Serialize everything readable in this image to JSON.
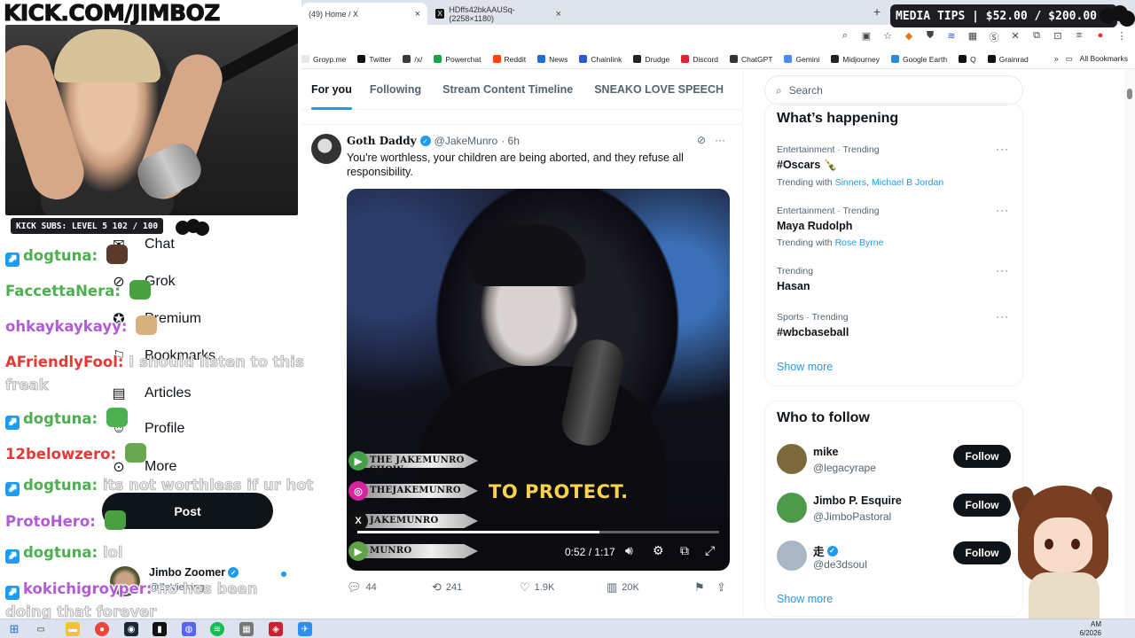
{
  "browser": {
    "tabs": [
      {
        "label": "(49) Home / X",
        "active": true,
        "close_icon": "×"
      },
      {
        "label": "HDffs42bkAAUSq- (2258×1180)",
        "active": false,
        "close_icon": "×"
      }
    ],
    "new_tab_icon": "+",
    "bookmarks": [
      {
        "label": "Groyp.me",
        "color": "#e7e7e7"
      },
      {
        "label": "Twitter",
        "color": "#111111"
      },
      {
        "label": "/x/",
        "color": "#3a3a3a"
      },
      {
        "label": "Powerchat",
        "color": "#1aa34a"
      },
      {
        "label": "Reddit",
        "color": "#ff4500"
      },
      {
        "label": "News",
        "color": "#1d6fd8"
      },
      {
        "label": "Chainlink",
        "color": "#2a5ada"
      },
      {
        "label": "Drudge",
        "color": "#222222"
      },
      {
        "label": "Discord",
        "color": "#d23"
      },
      {
        "label": "ChatGPT",
        "color": "#333333"
      },
      {
        "label": "Gemini",
        "color": "#4c8bf5"
      },
      {
        "label": "Midjourney",
        "color": "#222222"
      },
      {
        "label": "Google Earth",
        "color": "#2a8bd8"
      },
      {
        "label": "Q",
        "color": "#111111"
      },
      {
        "label": "Grainrad",
        "color": "#111111"
      }
    ],
    "all_bookmarks": "All Bookmarks",
    "chevron": "»"
  },
  "x_nav": {
    "tabs": [
      "For you",
      "Following",
      "Stream Content Timeline",
      "SNEAKO LOVE SPEECH"
    ],
    "active_index": 0
  },
  "side_nav": {
    "items": [
      "Chat",
      "Grok",
      "Premium",
      "Bookmarks",
      "Articles",
      "Profile",
      "More"
    ],
    "post_label": "Post",
    "me_name": "Jimbo Zoomer",
    "me_handle": "@ZeViewing"
  },
  "post": {
    "author_name": "Goth Daddy",
    "handle": "@JakeMunro",
    "time": "· 6h",
    "text": "You're worthless, your children are being aborted, and they refuse all responsibility.",
    "video": {
      "caption": "TO PROTECT.",
      "brands": [
        "THE JAKEMUNRO SHOW",
        "THEJAKEMUNRO",
        "JAKEMUNRO",
        "MUNRO"
      ],
      "time_display": "0:52 / 1:17",
      "progress": 0.67
    },
    "stats": {
      "replies": "44",
      "reposts": "241",
      "likes": "1.9K",
      "views": "20K"
    }
  },
  "search": {
    "placeholder": "Search"
  },
  "whats_happening": {
    "title": "What’s happening",
    "trends": [
      {
        "category": "Entertainment · Trending",
        "name": "#Oscars 🍾",
        "with_label": "Trending with",
        "with": [
          "Sinners",
          "Michael B Jordan"
        ]
      },
      {
        "category": "Entertainment · Trending",
        "name": "Maya Rudolph",
        "with_label": "Trending with",
        "with": [
          "Rose Byrne"
        ]
      },
      {
        "category": "Trending",
        "name": "Hasan",
        "with_label": "",
        "with": []
      },
      {
        "category": "Sports · Trending",
        "name": "#wbcbaseball",
        "with_label": "",
        "with": []
      }
    ],
    "show_more": "Show more"
  },
  "who_to_follow": {
    "title": "Who to follow",
    "accounts": [
      {
        "name": "mike",
        "handle": "@legacyrape",
        "verified": false,
        "avatar_color": "#7d6a3c"
      },
      {
        "name": "Jimbo P. Esquire",
        "handle": "@JimboPastoral",
        "verified": false,
        "avatar_color": "#4c9a4a"
      },
      {
        "name": "走",
        "handle": "@de3dsoul",
        "verified": true,
        "avatar_color": "#a9b6c4"
      }
    ],
    "follow_label": "Follow",
    "show_more": "Show more"
  },
  "stream": {
    "banner": "KICK.COM/JIMBOZ",
    "subs": "KICK SUBS: LEVEL 5 102 / 100",
    "media_tips": "MEDIA TIPS | $52.00 / $200.00",
    "chat": [
      {
        "user": "dogtuna",
        "color": "#4caf50",
        "badge": true,
        "text": ""
      },
      {
        "user": "FaccettaNera",
        "color": "#4caf50",
        "badge": false,
        "text": ""
      },
      {
        "user": "ohkaykaykayy",
        "color": "#b15cd6",
        "badge": false,
        "text": ""
      },
      {
        "user": "AFriendlyFool",
        "color": "#e53935",
        "badge": false,
        "text": "I should listen to this freak"
      },
      {
        "user": "dogtuna",
        "color": "#4caf50",
        "badge": true,
        "text": ""
      },
      {
        "user": "12belowzero",
        "color": "#e53935",
        "badge": false,
        "text": ""
      },
      {
        "user": "dogtuna",
        "color": "#4caf50",
        "badge": true,
        "text": "its not worthless if ur hot"
      },
      {
        "user": "ProtoHero",
        "color": "#b15cd6",
        "badge": false,
        "text": ""
      },
      {
        "user": "dogtuna",
        "color": "#4caf50",
        "badge": true,
        "text": "lol"
      },
      {
        "user": "kokichigroyper",
        "color": "#b15cd6",
        "badge": true,
        "text": "no hes been doing that forever"
      }
    ]
  },
  "taskbar": {
    "time": "AM",
    "date": "6/2026"
  }
}
